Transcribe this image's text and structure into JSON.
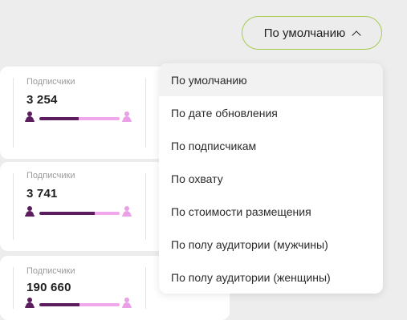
{
  "sort": {
    "label": "По умолчанию",
    "accent_color": "#a6cc4f"
  },
  "cards": [
    {
      "label": "Подписчики",
      "value": "3 254",
      "male_share": 0.49
    },
    {
      "label": "Подписчики",
      "value": "3 741",
      "male_share": 0.69
    },
    {
      "label": "Подписчики",
      "value": "190 660",
      "male_share": 0.5
    }
  ],
  "dropdown": {
    "selected_index": 0,
    "options": [
      "По умолчанию",
      "По дате обновления",
      "По подписчикам",
      "По охвату",
      "По стоимости размещения",
      "По полу аудитории (мужчины)",
      "По полу аудитории (женщины)"
    ]
  },
  "colors": {
    "male": "#5b1d5e",
    "female": "#eaa0e6",
    "background": "#ededed"
  },
  "icons": {
    "sort_chevron": "chevron-up-icon",
    "male": "male-user-icon",
    "female": "female-user-icon"
  }
}
